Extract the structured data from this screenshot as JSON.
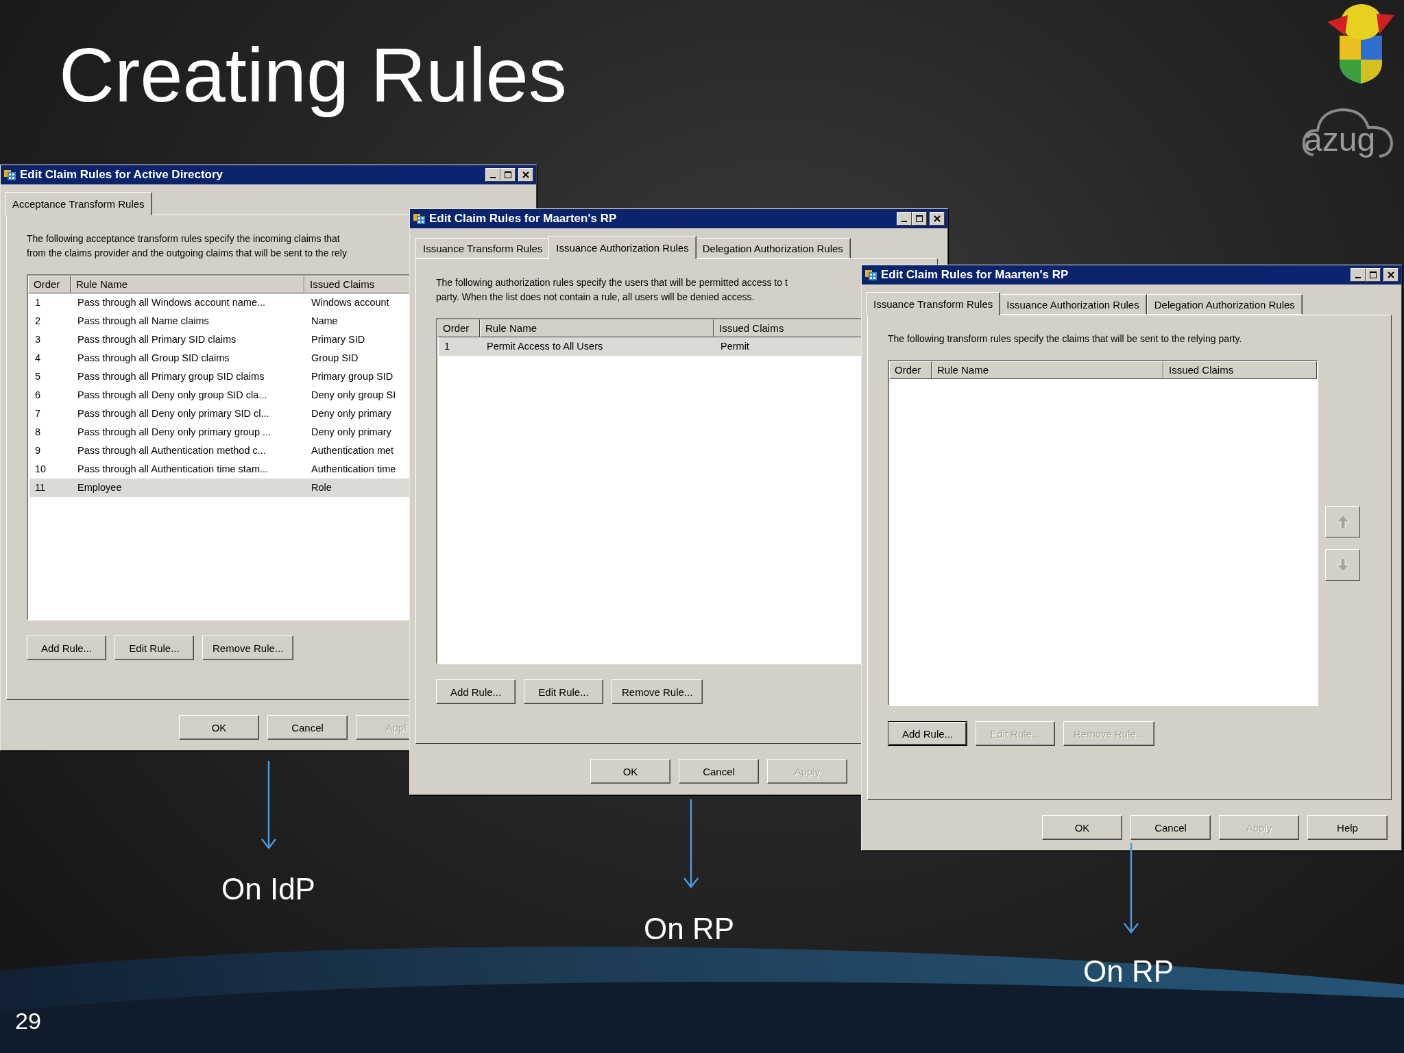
{
  "slide": {
    "title": "Creating Rules",
    "page_number": "29",
    "logo_text": "azug"
  },
  "windows": [
    {
      "title": "Edit Claim Rules for Active Directory",
      "tabs": [
        {
          "label": "Acceptance Transform Rules",
          "selected": true
        }
      ],
      "description": [
        "The following acceptance transform rules specify the incoming claims that",
        "from the claims provider and the outgoing claims that will be sent to the rely"
      ],
      "columns": [
        "Order",
        "Rule Name",
        "Issued Claims"
      ],
      "rows": [
        {
          "cells": [
            "1",
            "Pass through all Windows account name...",
            "Windows account"
          ],
          "selected": false
        },
        {
          "cells": [
            "2",
            "Pass through all Name claims",
            "Name"
          ],
          "selected": false
        },
        {
          "cells": [
            "3",
            "Pass through all Primary SID claims",
            "Primary SID"
          ],
          "selected": false
        },
        {
          "cells": [
            "4",
            "Pass through all Group SID claims",
            "Group SID"
          ],
          "selected": false
        },
        {
          "cells": [
            "5",
            "Pass through all Primary group SID claims",
            "Primary group SID"
          ],
          "selected": false
        },
        {
          "cells": [
            "6",
            "Pass through all Deny only group SID cla...",
            "Deny only group SI"
          ],
          "selected": false
        },
        {
          "cells": [
            "7",
            "Pass through all Deny only primary SID cl...",
            "Deny only primary"
          ],
          "selected": false
        },
        {
          "cells": [
            "8",
            "Pass through all Deny only primary group ...",
            "Deny only primary"
          ],
          "selected": false
        },
        {
          "cells": [
            "9",
            "Pass through all Authentication method c...",
            "Authentication met"
          ],
          "selected": false
        },
        {
          "cells": [
            "10",
            "Pass through all Authentication time stam...",
            "Authentication time"
          ],
          "selected": false
        },
        {
          "cells": [
            "11",
            "Employee",
            "Role"
          ],
          "selected": true
        }
      ],
      "rule_buttons": [
        {
          "label": "Add Rule...",
          "disabled": false,
          "default": false
        },
        {
          "label": "Edit Rule...",
          "disabled": false,
          "default": false
        },
        {
          "label": "Remove Rule...",
          "disabled": false,
          "default": false
        }
      ],
      "dialog_buttons": [
        {
          "label": "OK",
          "disabled": false
        },
        {
          "label": "Cancel",
          "disabled": false
        },
        {
          "label": "Appl",
          "disabled": true
        }
      ],
      "caption": "On IdP"
    },
    {
      "title": "Edit Claim Rules for Maarten's RP",
      "tabs": [
        {
          "label": "Issuance Transform Rules",
          "selected": false
        },
        {
          "label": "Issuance Authorization Rules",
          "selected": true
        },
        {
          "label": "Delegation Authorization Rules",
          "selected": false
        }
      ],
      "description": [
        "The following authorization rules specify the users that will be permitted access to t",
        "party. When the list does not contain a rule, all users will be denied access."
      ],
      "columns": [
        "Order",
        "Rule Name",
        "Issued Claims"
      ],
      "rows": [
        {
          "cells": [
            "1",
            "Permit Access to All Users",
            "Permit"
          ],
          "selected": true
        }
      ],
      "rule_buttons": [
        {
          "label": "Add Rule...",
          "disabled": false,
          "default": false
        },
        {
          "label": "Edit Rule...",
          "disabled": false,
          "default": false
        },
        {
          "label": "Remove Rule...",
          "disabled": false,
          "default": false
        }
      ],
      "dialog_buttons": [
        {
          "label": "OK",
          "disabled": false
        },
        {
          "label": "Cancel",
          "disabled": false
        },
        {
          "label": "Apply",
          "disabled": true
        }
      ],
      "caption": "On RP"
    },
    {
      "title": "Edit Claim Rules for Maarten's RP",
      "tabs": [
        {
          "label": "Issuance Transform Rules",
          "selected": true
        },
        {
          "label": "Issuance Authorization Rules",
          "selected": false
        },
        {
          "label": "Delegation Authorization Rules",
          "selected": false
        }
      ],
      "description": [
        "The following transform rules specify the claims that will be sent to the relying party."
      ],
      "columns": [
        "Order",
        "Rule Name",
        "Issued Claims"
      ],
      "move_buttons": [
        {
          "kind": "up",
          "disabled": true
        },
        {
          "kind": "down",
          "disabled": true
        }
      ],
      "rule_buttons": [
        {
          "label": "Add Rule...",
          "disabled": false,
          "default": true
        },
        {
          "label": "Edit Rule...",
          "disabled": true,
          "default": false
        },
        {
          "label": "Remove Rule...",
          "disabled": true,
          "default": false
        }
      ],
      "dialog_buttons": [
        {
          "label": "OK",
          "disabled": false
        },
        {
          "label": "Cancel",
          "disabled": false
        },
        {
          "label": "Apply",
          "disabled": true
        },
        {
          "label": "Help",
          "disabled": false
        }
      ],
      "caption": "On RP"
    }
  ]
}
